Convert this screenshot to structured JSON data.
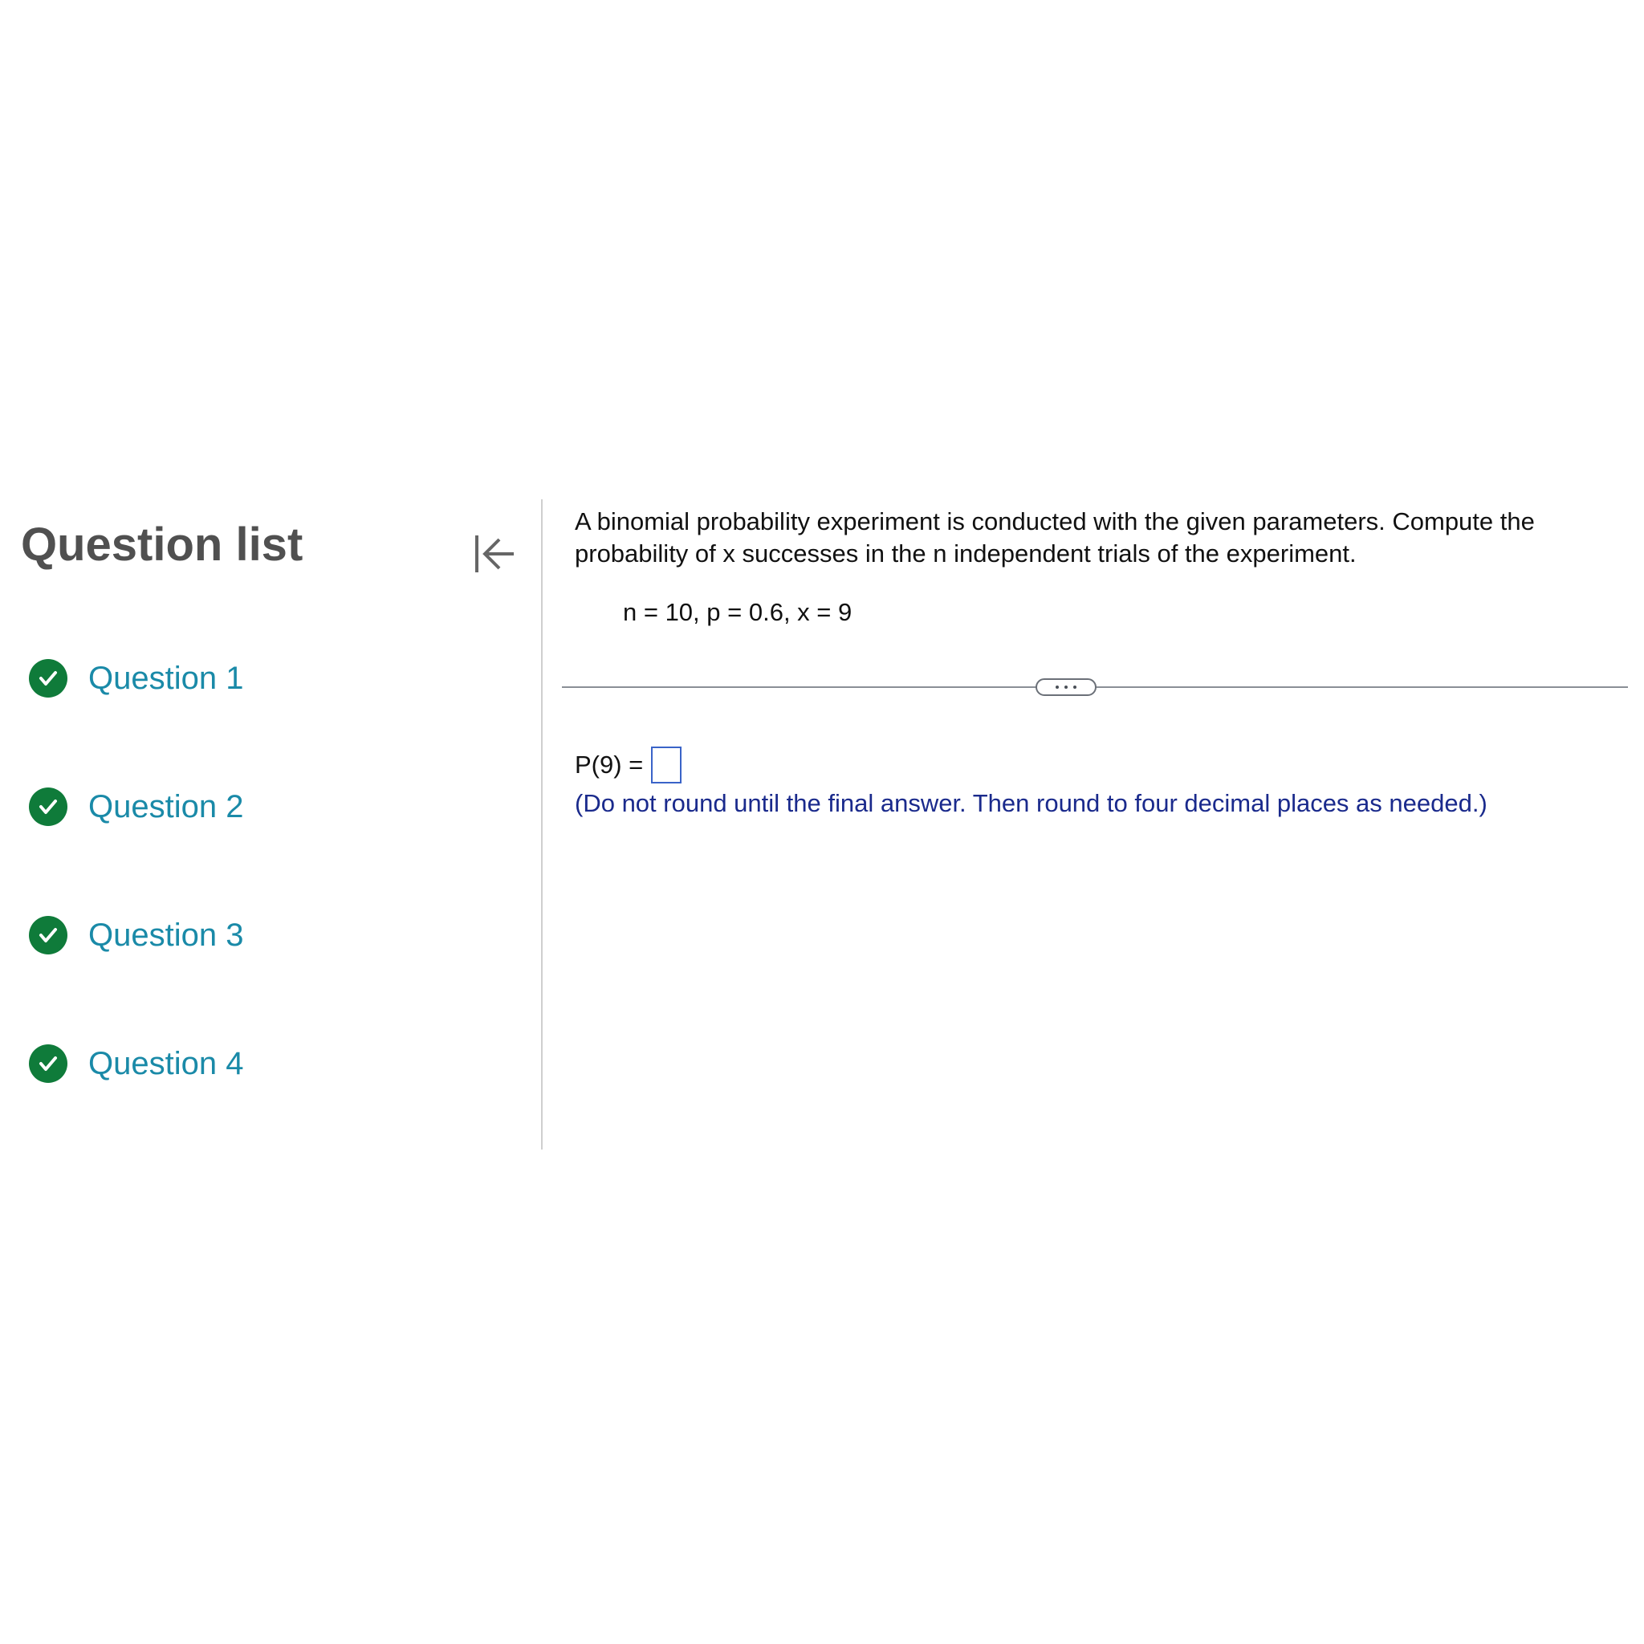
{
  "sidebar": {
    "title": "Question list",
    "collapse_icon": "collapse-left-icon",
    "items": [
      {
        "label": "Question 1",
        "status": "completed"
      },
      {
        "label": "Question 2",
        "status": "completed"
      },
      {
        "label": "Question 3",
        "status": "completed"
      },
      {
        "label": "Question 4",
        "status": "completed"
      }
    ]
  },
  "question": {
    "text": "A binomial probability experiment is conducted with the given parameters. Compute the probability of x successes in the n independent trials of the experiment.",
    "params": "n = 10, p = 0.6, x = 9"
  },
  "answer": {
    "label": "P(9) =",
    "value": "",
    "hint": "(Do not round until the final answer. Then round to four decimal places as needed.)"
  },
  "colors": {
    "check_green": "#0f7b3a",
    "link_teal": "#1a8aa8",
    "hint_navy": "#1a2a8c",
    "input_border": "#3a63c8"
  }
}
